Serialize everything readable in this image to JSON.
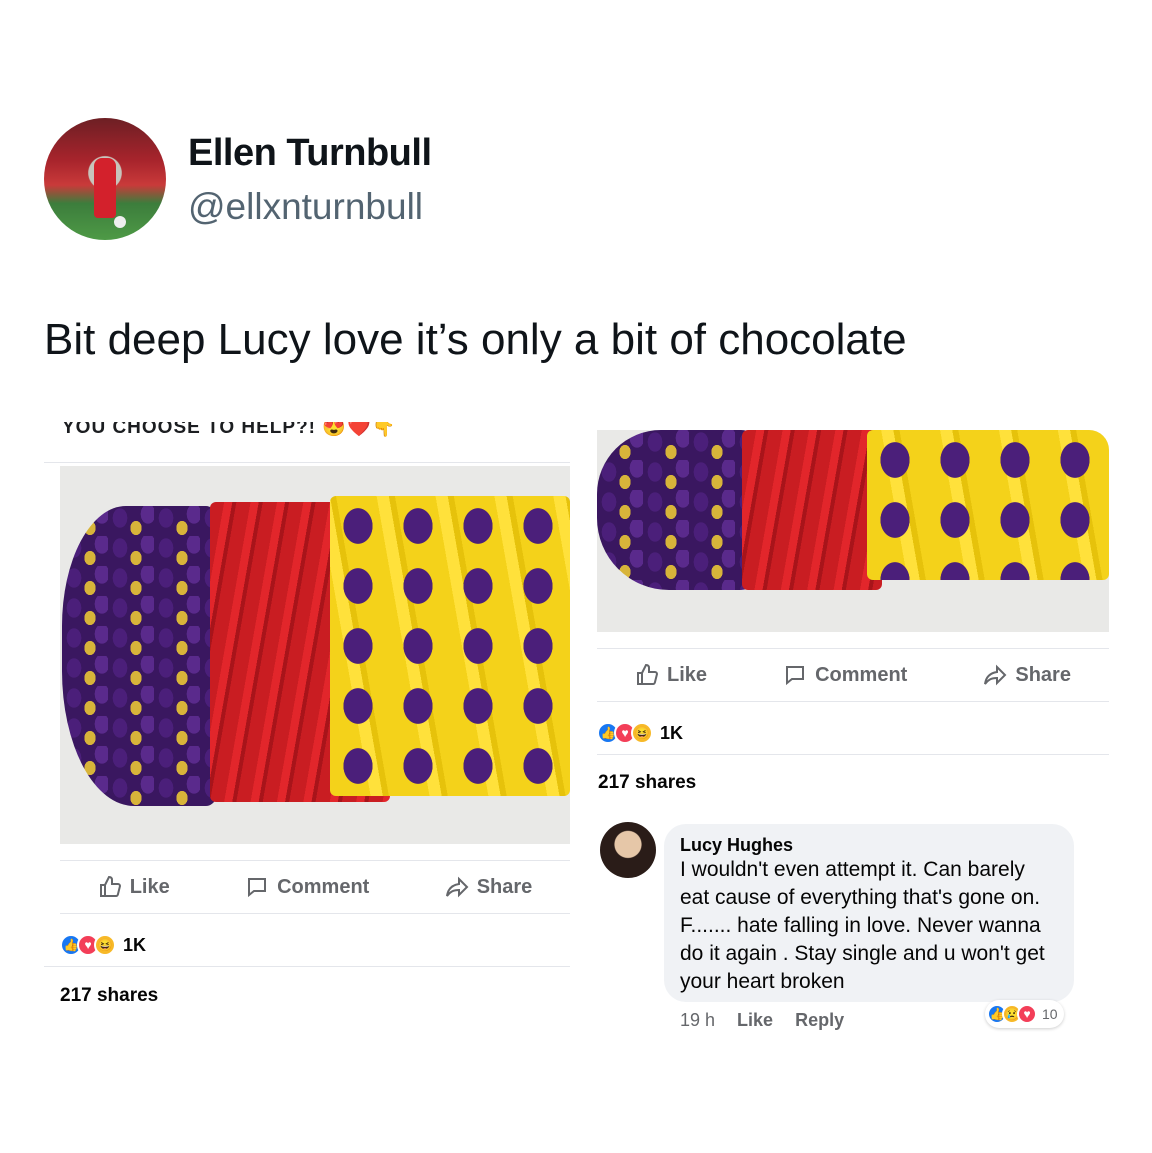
{
  "tweet": {
    "display_name": "Ellen Turnbull",
    "handle": "@ellxnturnbull",
    "text": "Bit deep Lucy love it’s only a bit of chocolate"
  },
  "left_post": {
    "cut_off_caption": "YOU CHOOSE TO HELP?! 😍❤️👇",
    "actions": {
      "like": "Like",
      "comment": "Comment",
      "share": "Share"
    },
    "reaction_count": "1K",
    "shares": "217 shares"
  },
  "right_post": {
    "actions": {
      "like": "Like",
      "comment": "Comment",
      "share": "Share"
    },
    "reaction_count": "1K",
    "shares": "217 shares",
    "comment": {
      "author": "Lucy Hughes",
      "text": "I wouldn't even attempt it. Can barely eat cause of everything that's gone on. F....... hate falling in love. Never wanna do it again . Stay single and u won't get your heart broken",
      "time": "19 h",
      "like": "Like",
      "reply": "Reply",
      "reaction_count": "10"
    }
  },
  "colors": {
    "fb_blue": "#1877f2",
    "fb_grey_text": "#65676b",
    "twitter_grey": "#536471",
    "love_red": "#f33e58"
  }
}
